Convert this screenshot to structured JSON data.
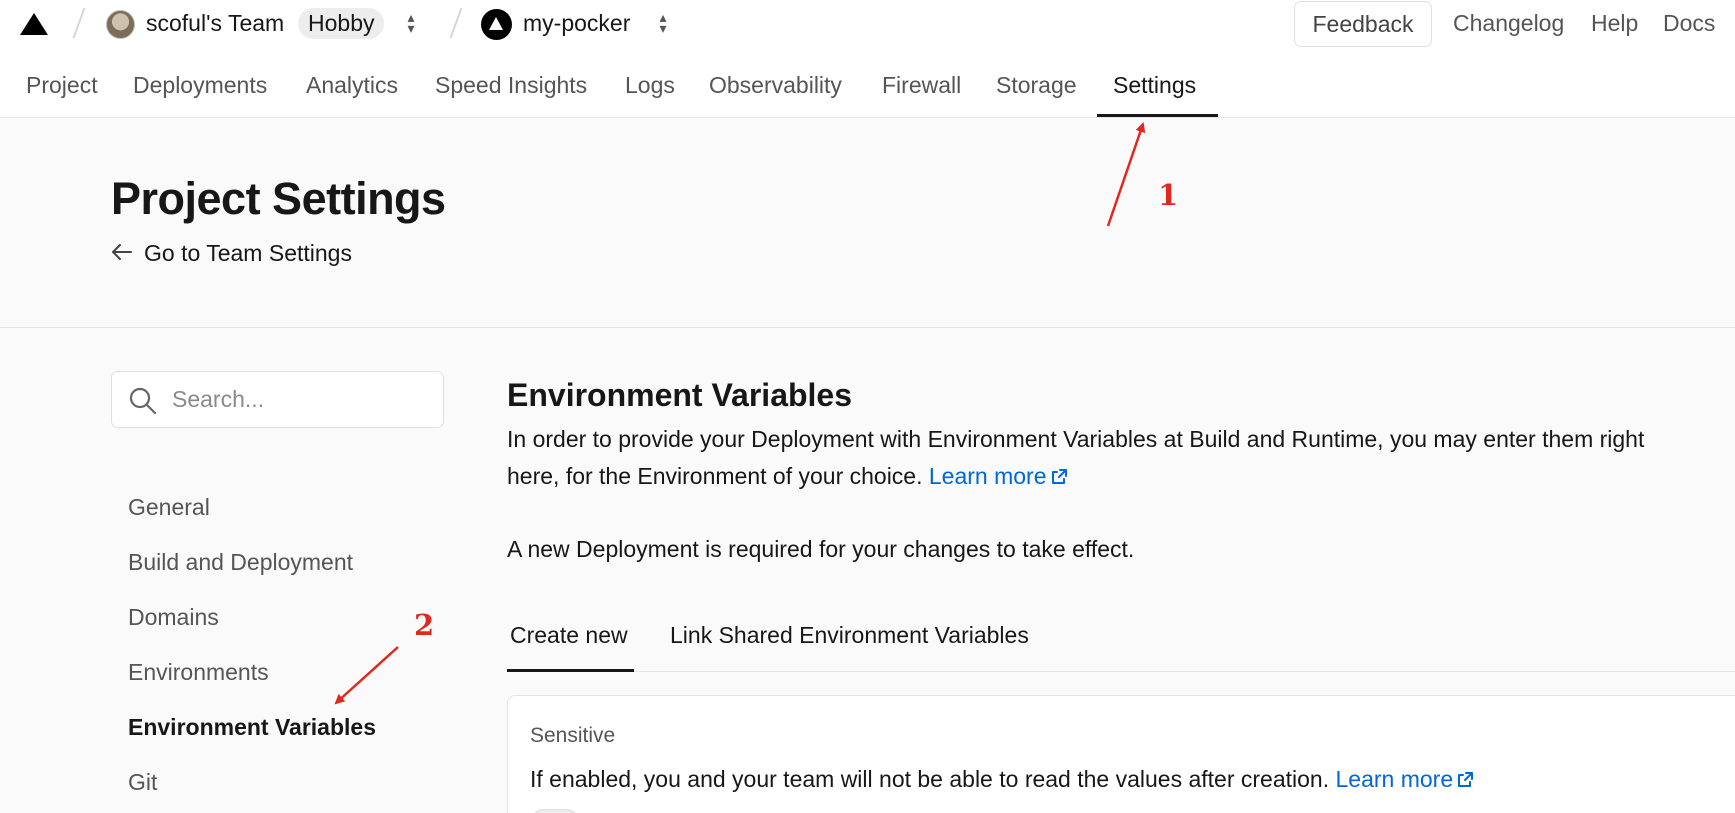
{
  "header": {
    "team": {
      "name": "scoful's Team",
      "plan": "Hobby"
    },
    "project": {
      "name": "my-pocker"
    },
    "links": {
      "feedback": "Feedback",
      "changelog": "Changelog",
      "help": "Help",
      "docs": "Docs"
    },
    "icons": [
      "vercel-logo-icon",
      "avatar",
      "chevron-updown-icon",
      "project-icon"
    ]
  },
  "nav": {
    "tabs": [
      {
        "label": "Project"
      },
      {
        "label": "Deployments"
      },
      {
        "label": "Analytics"
      },
      {
        "label": "Speed Insights"
      },
      {
        "label": "Logs"
      },
      {
        "label": "Observability"
      },
      {
        "label": "Firewall"
      },
      {
        "label": "Storage"
      },
      {
        "label": "Settings",
        "active": true
      }
    ]
  },
  "hero": {
    "title": "Project Settings",
    "back_link": "Go to Team Settings"
  },
  "sidebar": {
    "search_placeholder": "Search...",
    "items": [
      {
        "label": "General"
      },
      {
        "label": "Build and Deployment"
      },
      {
        "label": "Domains"
      },
      {
        "label": "Environments"
      },
      {
        "label": "Environment Variables",
        "active": true
      },
      {
        "label": "Git"
      }
    ]
  },
  "main": {
    "title": "Environment Variables",
    "description_line1": "In order to provide your Deployment with Environment Variables at Build and Runtime, you may enter them right",
    "description_line2": "here, for the Environment of your choice.",
    "learn_more": "Learn more",
    "notice": "A new Deployment is required for your changes to take effect.",
    "tabs": [
      {
        "label": "Create new",
        "active": true
      },
      {
        "label": "Link Shared Environment Variables"
      }
    ],
    "sensitive": {
      "label": "Sensitive",
      "text": "If enabled, you and your team will not be able to read the values after creation.",
      "learn_more": "Learn more"
    }
  },
  "annotations": [
    {
      "label": "1"
    },
    {
      "label": "2"
    }
  ],
  "colors": {
    "link": "#0068d6",
    "annotation": "#e0281f",
    "text": "#171717",
    "muted": "#555555"
  }
}
